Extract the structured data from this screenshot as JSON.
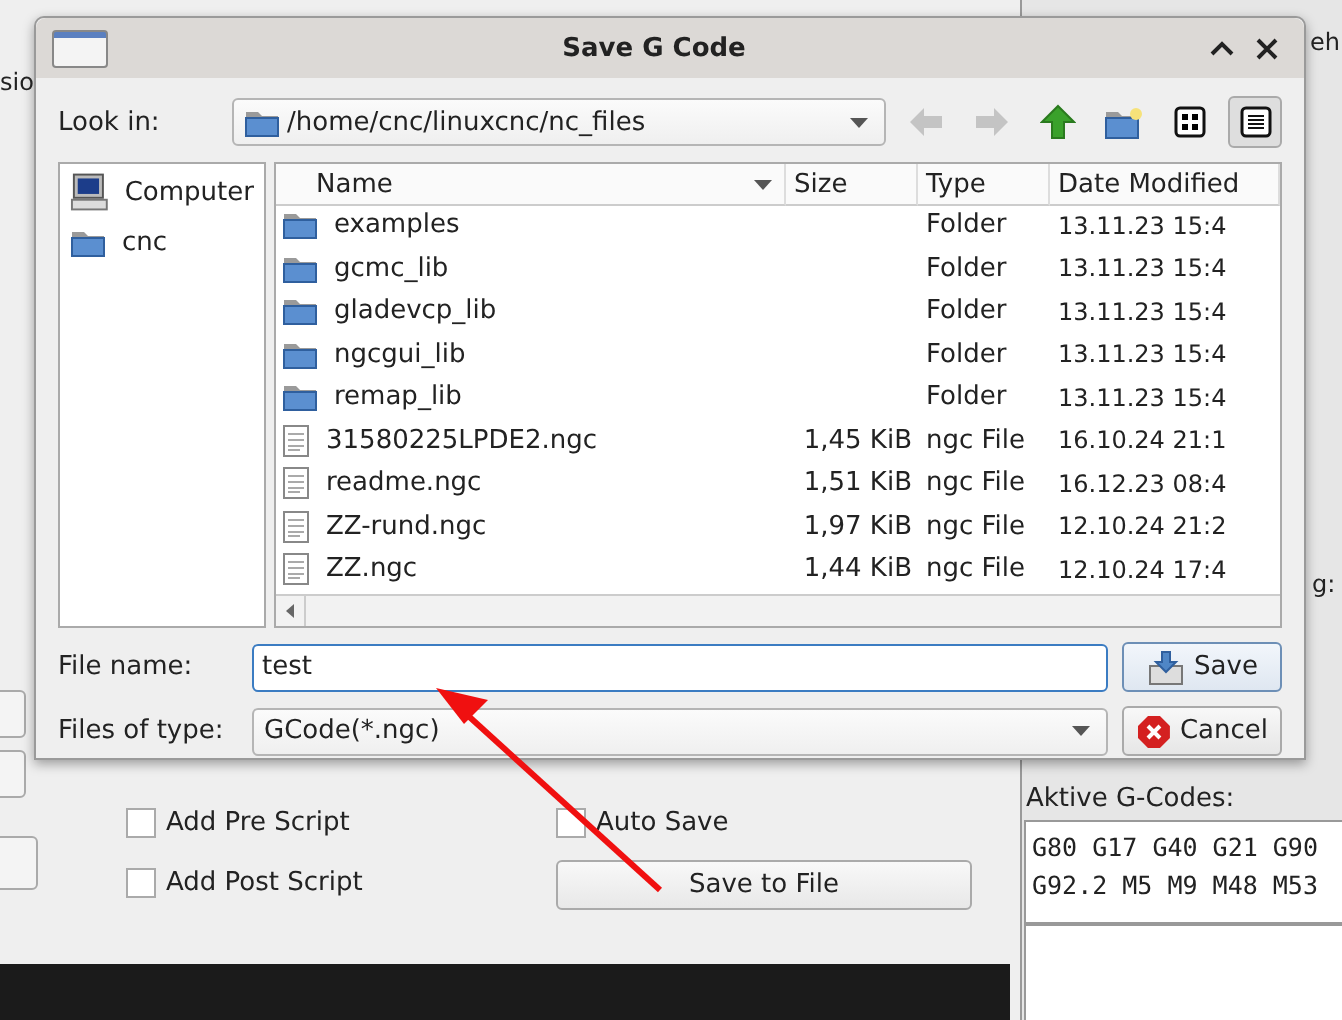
{
  "background_app": {
    "fragments": [
      "sio",
      "eh",
      "g:"
    ],
    "options": [
      {
        "label": "Add Pre Script",
        "checked": false
      },
      {
        "label": "Add Post Script",
        "checked": false
      }
    ],
    "auto_save": {
      "label": "Auto Save",
      "checked": false
    },
    "save_button": "Save to File",
    "active_gcodes": {
      "label": "Aktive G-Codes:",
      "lines": [
        "G80 G17 G40 G21 G90",
        "G92.2 M5 M9 M48 M53"
      ]
    }
  },
  "dialog": {
    "title": "Save G Code",
    "look_in": {
      "label": "Look in:",
      "path": "/home/cnc/linuxcnc/nc_files"
    },
    "nav_buttons": [
      {
        "kind": "back",
        "disabled": true
      },
      {
        "kind": "forward",
        "disabled": true
      },
      {
        "kind": "up",
        "disabled": false
      },
      {
        "kind": "new-folder",
        "disabled": false
      }
    ],
    "view_buttons": [
      {
        "kind": "list",
        "selected": false
      },
      {
        "kind": "detail",
        "selected": true
      }
    ],
    "places": [
      {
        "label": "Computer",
        "kind": "computer"
      },
      {
        "label": "cnc",
        "kind": "folder"
      }
    ],
    "columns": [
      "Name",
      "Size",
      "Type",
      "Date Modified"
    ],
    "files": [
      {
        "kind": "folder",
        "name": "examples",
        "type": "Folder",
        "date": "13.11.23 15:4"
      },
      {
        "kind": "folder",
        "name": "gcmc_lib",
        "type": "Folder",
        "date": "13.11.23 15:4"
      },
      {
        "kind": "folder",
        "name": "gladevcp_lib",
        "type": "Folder",
        "date": "13.11.23 15:4"
      },
      {
        "kind": "folder",
        "name": "ngcgui_lib",
        "type": "Folder",
        "date": "13.11.23 15:4"
      },
      {
        "kind": "folder",
        "name": "remap_lib",
        "type": "Folder",
        "date": "13.11.23 15:4"
      },
      {
        "kind": "file",
        "name": "31580225LPDE2.ngc",
        "size": "1,45 KiB",
        "type": "ngc File",
        "date": "16.10.24 21:1"
      },
      {
        "kind": "file",
        "name": "readme.ngc",
        "size": "1,51 KiB",
        "type": "ngc File",
        "date": "16.12.23 08:4"
      },
      {
        "kind": "file",
        "name": "ZZ-rund.ngc",
        "size": "1,97 KiB",
        "type": "ngc File",
        "date": "12.10.24 21:2"
      },
      {
        "kind": "file",
        "name": "ZZ.ngc",
        "size": "1,44 KiB",
        "type": "ngc File",
        "date": "12.10.24 17:4"
      }
    ],
    "file_name": {
      "label": "File name:",
      "value": "test"
    },
    "file_type": {
      "label": "Files of type:",
      "value": "GCode(*.ngc)"
    },
    "buttons": [
      {
        "kind": "save",
        "label": "Save"
      },
      {
        "kind": "cancel",
        "label": "Cancel"
      }
    ]
  }
}
